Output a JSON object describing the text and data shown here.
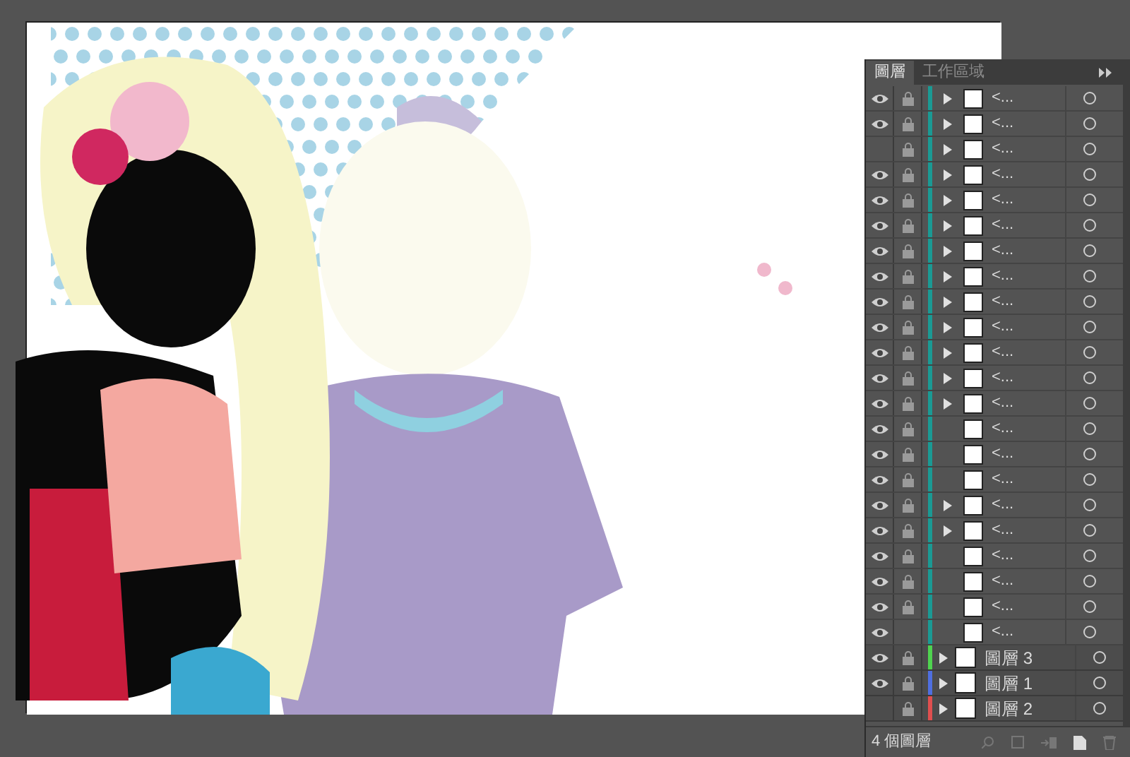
{
  "panel": {
    "tabs": [
      {
        "label": "圖層",
        "selected": true
      },
      {
        "label": "工作區域",
        "selected": false
      }
    ],
    "sublayers": [
      {
        "name": "<...",
        "visible": true,
        "locked": true,
        "expandable": true,
        "color": "#1a9a94"
      },
      {
        "name": "<...",
        "visible": true,
        "locked": true,
        "expandable": true,
        "color": "#1a9a94"
      },
      {
        "name": "<...",
        "visible": false,
        "locked": true,
        "expandable": true,
        "color": "#1a9a94"
      },
      {
        "name": "<...",
        "visible": true,
        "locked": true,
        "expandable": true,
        "color": "#1a9a94"
      },
      {
        "name": "<...",
        "visible": true,
        "locked": true,
        "expandable": true,
        "color": "#1a9a94"
      },
      {
        "name": "<...",
        "visible": true,
        "locked": true,
        "expandable": true,
        "color": "#1a9a94"
      },
      {
        "name": "<...",
        "visible": true,
        "locked": true,
        "expandable": true,
        "color": "#1a9a94"
      },
      {
        "name": "<...",
        "visible": true,
        "locked": true,
        "expandable": true,
        "color": "#1a9a94"
      },
      {
        "name": "<...",
        "visible": true,
        "locked": true,
        "expandable": true,
        "color": "#1a9a94"
      },
      {
        "name": "<...",
        "visible": true,
        "locked": true,
        "expandable": true,
        "color": "#1a9a94"
      },
      {
        "name": "<...",
        "visible": true,
        "locked": true,
        "expandable": true,
        "color": "#1a9a94"
      },
      {
        "name": "<...",
        "visible": true,
        "locked": true,
        "expandable": true,
        "color": "#1a9a94"
      },
      {
        "name": "<...",
        "visible": true,
        "locked": true,
        "expandable": true,
        "color": "#1a9a94"
      },
      {
        "name": "<...",
        "visible": true,
        "locked": true,
        "expandable": false,
        "color": "#1a9a94"
      },
      {
        "name": "<...",
        "visible": true,
        "locked": true,
        "expandable": false,
        "color": "#1a9a94"
      },
      {
        "name": "<...",
        "visible": true,
        "locked": true,
        "expandable": false,
        "color": "#1a9a94"
      },
      {
        "name": "<...",
        "visible": true,
        "locked": true,
        "expandable": true,
        "color": "#1a9a94"
      },
      {
        "name": "<...",
        "visible": true,
        "locked": true,
        "expandable": true,
        "color": "#1a9a94"
      },
      {
        "name": "<...",
        "visible": true,
        "locked": true,
        "expandable": false,
        "color": "#1a9a94"
      },
      {
        "name": "<...",
        "visible": true,
        "locked": true,
        "expandable": false,
        "color": "#1a9a94"
      },
      {
        "name": "<...",
        "visible": true,
        "locked": true,
        "expandable": false,
        "color": "#1a9a94"
      },
      {
        "name": "<...",
        "visible": true,
        "locked": false,
        "expandable": false,
        "color": "#1a9a94"
      }
    ],
    "layers": [
      {
        "name": "圖層 3",
        "visible": true,
        "locked": true,
        "color": "#4fd34f"
      },
      {
        "name": "圖層 1",
        "visible": true,
        "locked": true,
        "color": "#4f6fe0"
      },
      {
        "name": "圖層 2",
        "visible": false,
        "locked": true,
        "color": "#e04f4f"
      }
    ],
    "footer": "4 個圖層"
  }
}
